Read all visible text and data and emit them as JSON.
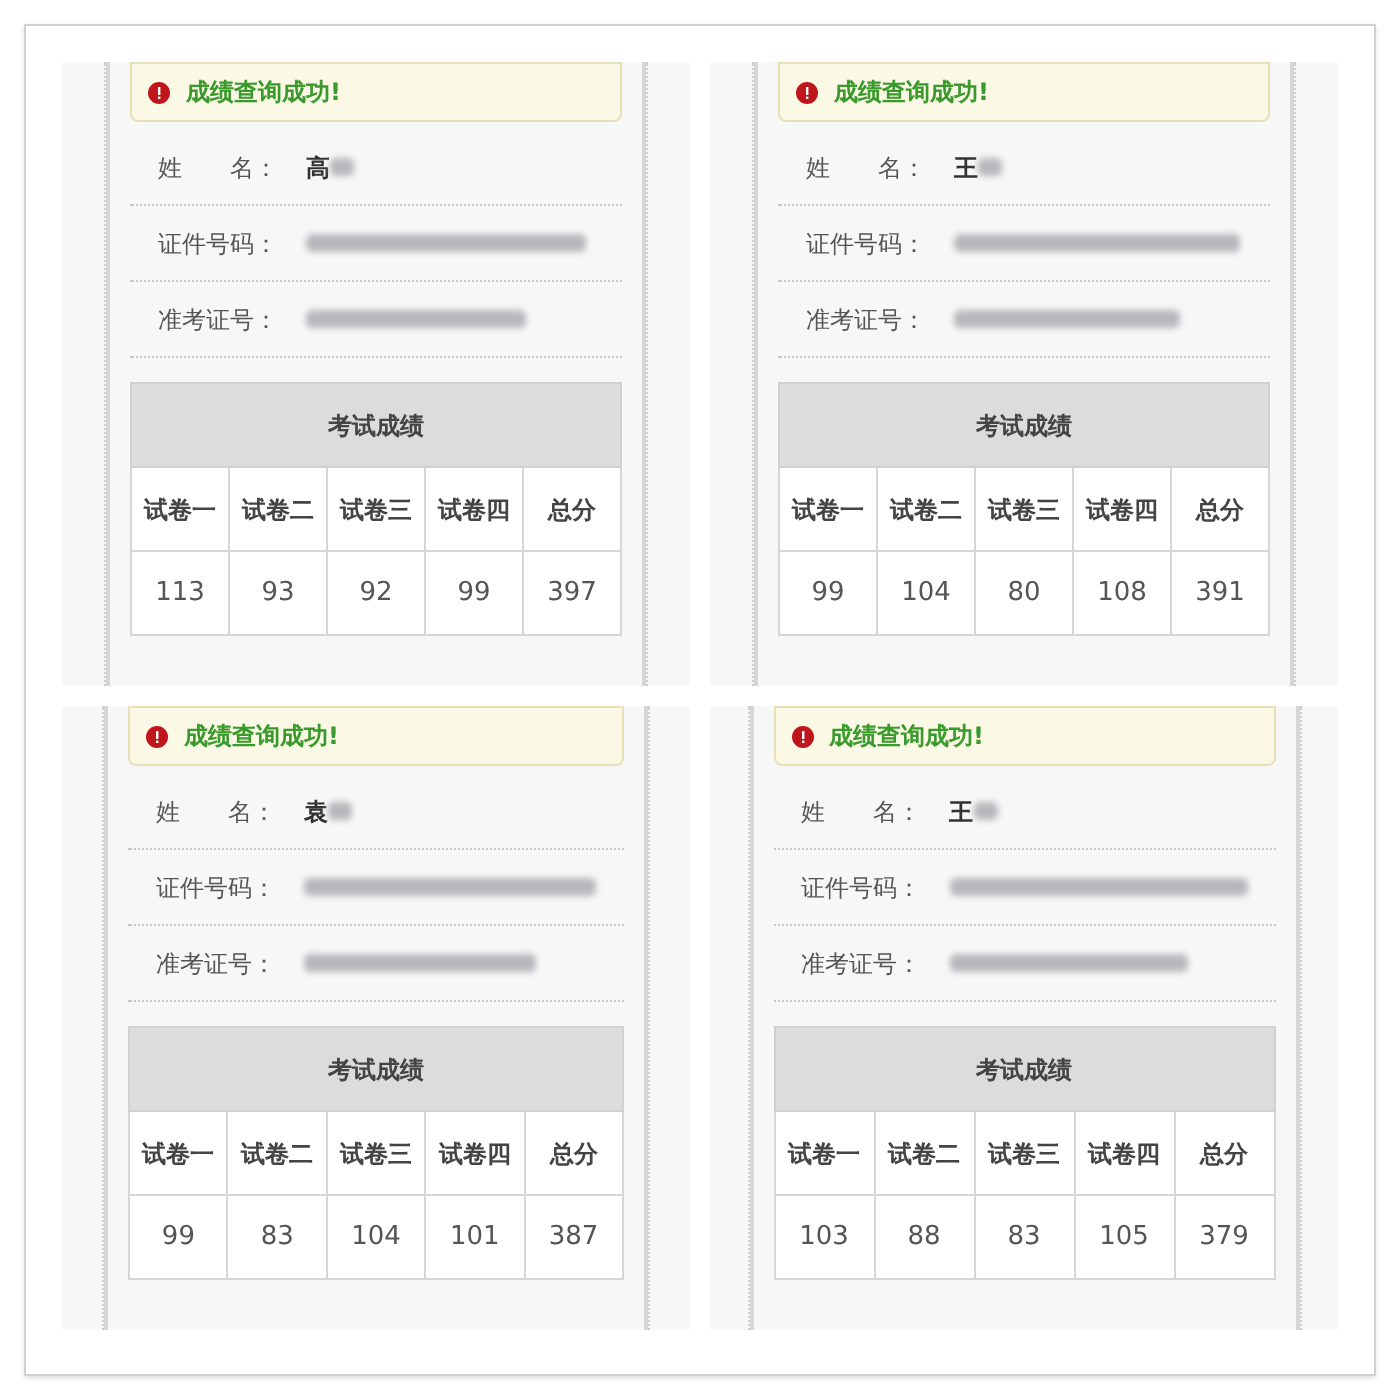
{
  "panels": [
    {
      "alert": "成绩查询成功!",
      "fields": [
        {
          "label": "姓　　名：",
          "value": "高",
          "redacted": true
        },
        {
          "label": "证件号码：",
          "redacted": true
        },
        {
          "label": "准考证号：",
          "redacted": true
        }
      ],
      "table": {
        "title": "考试成绩",
        "columns": [
          "试卷一",
          "试卷二",
          "试卷三",
          "试卷四",
          "总分"
        ],
        "rows": [
          [
            "113",
            "93",
            "92",
            "99",
            "397"
          ]
        ]
      }
    },
    {
      "alert": "成绩查询成功!",
      "fields": [
        {
          "label": "姓　　名：",
          "value": "王",
          "redacted": true
        },
        {
          "label": "证件号码：",
          "redacted": true
        },
        {
          "label": "准考证号：",
          "redacted": true
        }
      ],
      "table": {
        "title": "考试成绩",
        "columns": [
          "试卷一",
          "试卷二",
          "试卷三",
          "试卷四",
          "总分"
        ],
        "rows": [
          [
            "99",
            "104",
            "80",
            "108",
            "391"
          ]
        ]
      }
    },
    {
      "alert": "成绩查询成功!",
      "fields": [
        {
          "label": "姓　　名：",
          "value": "袁",
          "redacted": true
        },
        {
          "label": "证件号码：",
          "redacted": true
        },
        {
          "label": "准考证号：",
          "redacted": true
        }
      ],
      "table": {
        "title": "考试成绩",
        "columns": [
          "试卷一",
          "试卷二",
          "试卷三",
          "试卷四",
          "总分"
        ],
        "rows": [
          [
            "99",
            "83",
            "104",
            "101",
            "387"
          ]
        ]
      }
    },
    {
      "alert": "成绩查询成功!",
      "fields": [
        {
          "label": "姓　　名：",
          "value": "王",
          "redacted": true
        },
        {
          "label": "证件号码：",
          "redacted": true
        },
        {
          "label": "准考证号：",
          "redacted": true
        }
      ],
      "table": {
        "title": "考试成绩",
        "columns": [
          "试卷一",
          "试卷二",
          "试卷三",
          "试卷四",
          "总分"
        ],
        "rows": [
          [
            "103",
            "88",
            "83",
            "105",
            "379"
          ]
        ]
      }
    }
  ]
}
